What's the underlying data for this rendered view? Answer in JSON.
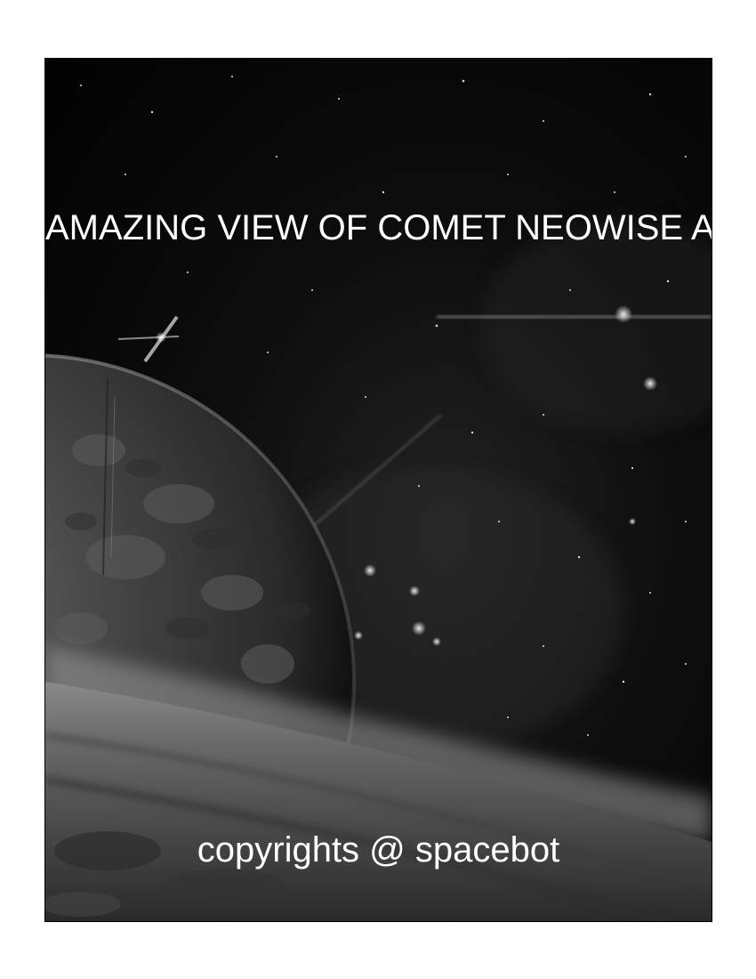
{
  "poster": {
    "title": "AMAZING VIEW OF COMET NEOWISE AFTER SUNSET",
    "credit": "copyrights @ spacebot"
  }
}
